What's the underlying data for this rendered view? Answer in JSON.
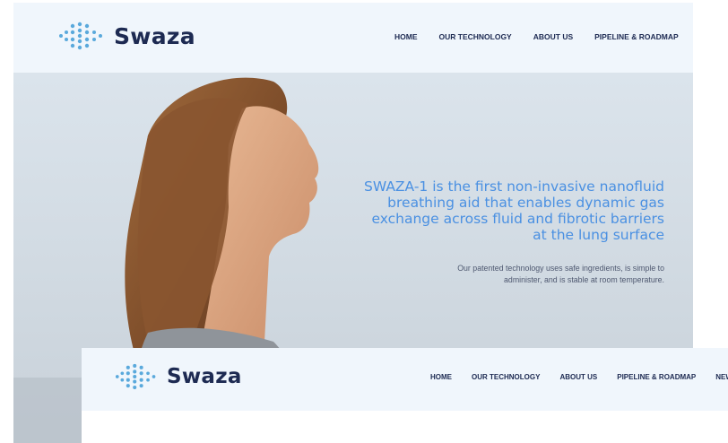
{
  "brand": {
    "name": "Swaza",
    "logo_icon": "dna-helix-icon",
    "colors": {
      "accent": "#4a90e2",
      "navy": "#1d2a52",
      "header_bg": "#f0f6fc",
      "dot": "#5aa9dc"
    }
  },
  "nav": {
    "items": [
      "HOME",
      "OUR TECHNOLOGY",
      "ABOUT US",
      "PIPELINE & ROADMAP",
      "NEWS"
    ]
  },
  "hero": {
    "heading_lines": [
      "SWAZA-1 is the first non-invasive nanofluid",
      "breathing aid that enables dynamic gas",
      "exchange across fluid and fibrotic barriers",
      "at the lung surface"
    ],
    "subtext_lines": [
      "Our patented technology uses safe ingredients, is simple to",
      "administer, and is stable at room temperature."
    ]
  }
}
